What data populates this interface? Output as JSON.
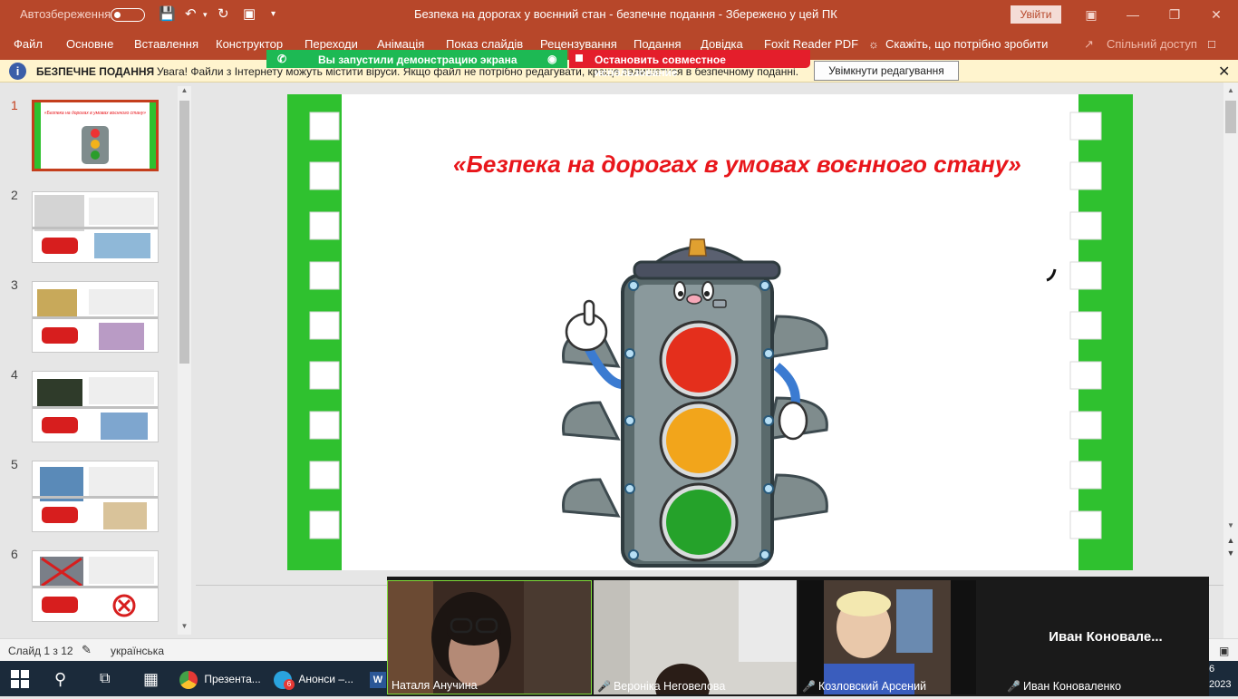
{
  "titlebar": {
    "autosave_label": "Автозбереження",
    "doc_title": "Безпека на дорогах у воєнний стан  -  безпечне подання  -  Збережено у цей ПК",
    "signin_label": "Увійти"
  },
  "ribbon": {
    "tabs": [
      "Файл",
      "Основне",
      "Вставлення",
      "Конструктор",
      "Переходи",
      "Анімація",
      "Показ слайдів",
      "Рецензування",
      "Подання",
      "Довідка",
      "Foxit Reader PDF"
    ],
    "tell_me": "Скажіть, що потрібно зробити",
    "share": "Спільний доступ"
  },
  "infobar": {
    "title": "БЕЗПЕЧНЕ ПОДАННЯ",
    "message": "Увага! Файли з Інтернету можуть містити віруси. Якщо файл не потрібно редагувати, краще залишатися в безпечному поданні.",
    "enable_button": "Увімкнути редагування"
  },
  "sharing": {
    "started_text": "Вы запустили демонстрацию экрана",
    "stop_text": "Остановить совместное использование"
  },
  "slides_panel": {
    "numbers": [
      "1",
      "2",
      "3",
      "4",
      "5",
      "6"
    ],
    "active_index": 0,
    "thumb1_title": "«Безпека на дорогах в умовах воєнного стану»"
  },
  "slide": {
    "title": "«Безпека на дорогах в умовах воєнного стану»"
  },
  "statusbar": {
    "slide_counter": "Слайд 1 з 12",
    "language": "українська"
  },
  "video": {
    "tiles": [
      {
        "name": "Наталя Анучина",
        "muted": false
      },
      {
        "name": "Вероніка Негoвелова",
        "muted": true
      },
      {
        "name": "Козловский Арсений",
        "muted": true
      },
      {
        "name": "Иван Коноваленко",
        "muted": true
      }
    ],
    "big_name": "Иван  Коновале..."
  },
  "taskbar": {
    "apps": [
      "Презента...",
      "Анонси –..."
    ],
    "telegram_badge": "6",
    "clock_fragment": "6",
    "year_fragment": "2023"
  },
  "colors": {
    "accent": "#b7472a",
    "slide_green": "#2fc12f",
    "title_red": "#e8161b"
  }
}
